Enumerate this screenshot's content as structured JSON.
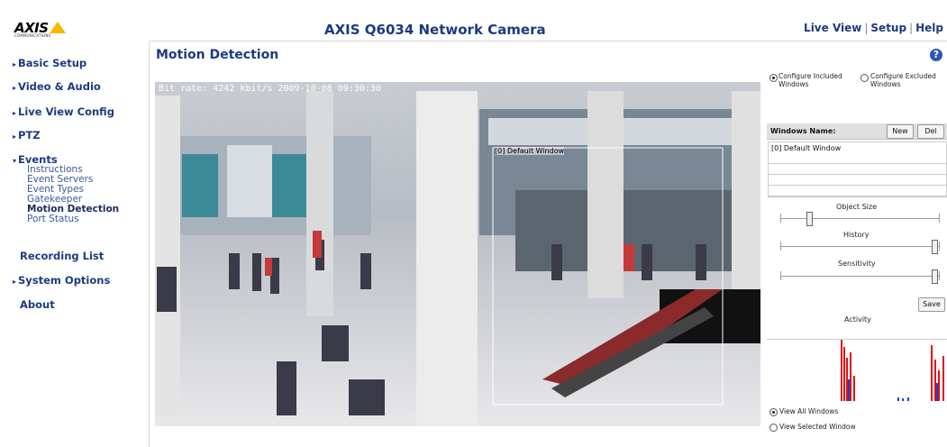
{
  "header": {
    "logo_text": "AXIS",
    "logo_sub": "COMMUNICATIONS",
    "title": "AXIS Q6034 Network Camera",
    "nav": {
      "live_view": "Live View",
      "setup": "Setup",
      "help": "Help",
      "sep": "|"
    }
  },
  "sidebar": {
    "basic_setup": "Basic Setup",
    "video_audio": "Video & Audio",
    "live_view_config": "Live View Config",
    "ptz": "PTZ",
    "events": "Events",
    "events_items": [
      "Instructions",
      "Event Servers",
      "Event Types",
      "Gatekeeper",
      "Motion Detection",
      "Port Status"
    ],
    "recording_list": "Recording List",
    "system_options": "System Options",
    "about": "About"
  },
  "main": {
    "section_title": "Motion Detection",
    "video_overlay": "Bit rate:  4242 kbit/s 2009-10-08 09:30:30",
    "window_label": "[0] Default Window"
  },
  "panel": {
    "config_included": "Configure Included Windows",
    "config_included_l1": "Configure Included",
    "config_included_l2": "Windows",
    "config_excluded_l1": "Configure Excluded",
    "config_excluded_l2": "Windows",
    "windows_name_label": "Windows Name:",
    "new_button": "New",
    "del_button": "Del",
    "window_items": [
      "[0] Default Window"
    ],
    "object_size_label": "Object Size",
    "history_label": "History",
    "sensitivity_label": "Sensitivity",
    "save_button": "Save",
    "activity_label": "Activity",
    "view_all": "View All Windows",
    "view_selected": "View Selected Window",
    "slider_levels": {
      "object_size": 0.18,
      "history": 0.97,
      "sensitivity": 0.97
    }
  },
  "colors": {
    "brand": "#1c3a80",
    "link": "#3a5a98",
    "activity_red": "#e01010",
    "activity_blue": "#2040d0"
  }
}
